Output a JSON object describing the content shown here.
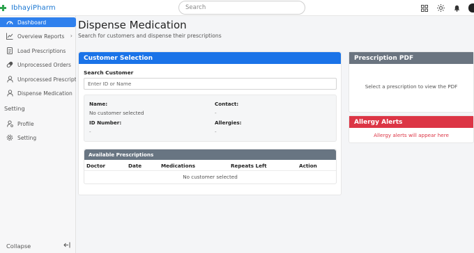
{
  "app": {
    "brand": "IbhayiPharm"
  },
  "search": {
    "placeholder": "Search"
  },
  "sidebar": {
    "items": [
      {
        "label": "Dashboard",
        "icon": "speedometer-icon"
      },
      {
        "label": "Overview Reports",
        "icon": "chart-line-icon"
      },
      {
        "label": "Load Prescriptions",
        "icon": "document-icon"
      },
      {
        "label": "Unprocessed Orders",
        "icon": "capsule-icon"
      },
      {
        "label": "Unprocessed Prescriptions",
        "icon": "user-icon"
      },
      {
        "label": "Dispense Medication",
        "icon": "user-icon"
      }
    ],
    "section_label": "Setting",
    "settings_items": [
      {
        "label": "Profile",
        "icon": "person-gear-icon"
      },
      {
        "label": "Setting",
        "icon": "gear-icon"
      }
    ],
    "collapse_label": "Collapse"
  },
  "page": {
    "title": "Dispense Medication",
    "subtitle": "Search for customers and dispense their prescriptions"
  },
  "customer_selection": {
    "header": "Customer Selection",
    "search_label": "Search Customer",
    "search_placeholder": "Enter ID or Name",
    "info": {
      "name_label": "Name:",
      "name_value": "No customer selected",
      "contact_label": "Contact:",
      "contact_value": "-",
      "id_label": "ID Number:",
      "id_value": "-",
      "allergies_label": "Allergies:",
      "allergies_value": "-"
    },
    "prescriptions": {
      "header": "Available Prescriptions",
      "columns": [
        "Doctor",
        "Date",
        "Medications",
        "Repeats Left",
        "Action"
      ],
      "empty_message": "No customer selected"
    }
  },
  "prescription_pdf": {
    "header": "Prescription PDF",
    "message": "Select a prescription to view the PDF"
  },
  "allergy_alerts": {
    "header": "Allergy Alerts",
    "message": "Allergy alerts will appear here"
  },
  "colors": {
    "primary": "#1a73e8",
    "active_nav": "#2f80ed",
    "danger": "#dc3545",
    "muted_header": "#6a7480",
    "brand_icon": "#2ea44f"
  }
}
